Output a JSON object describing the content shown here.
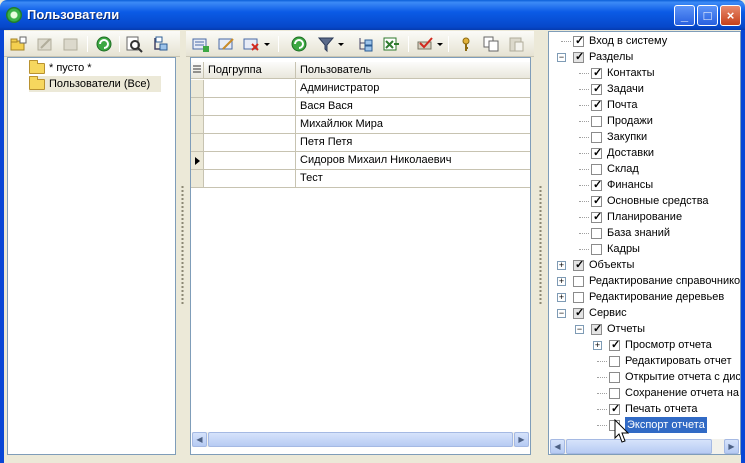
{
  "window": {
    "title": "Пользователи"
  },
  "left_panel": {
    "groups": [
      {
        "label": "* пусто *"
      },
      {
        "label": "Пользователи (Все)"
      }
    ]
  },
  "grid": {
    "columns": [
      "Подгруппа",
      "Пользователь"
    ],
    "rows": [
      {
        "subgroup": "",
        "user": "Администратор"
      },
      {
        "subgroup": "",
        "user": "Вася Вася"
      },
      {
        "subgroup": "",
        "user": "Михайлюк Мира"
      },
      {
        "subgroup": "",
        "user": "Петя Петя"
      },
      {
        "subgroup": "",
        "user": "Сидоров Михаил Николаевич"
      },
      {
        "subgroup": "",
        "user": "Тест"
      }
    ],
    "current_row": 4
  },
  "rights_tree": {
    "items": [
      {
        "label": "Вход в систему",
        "checked": true,
        "level": 0
      },
      {
        "label": "Разделы",
        "checked": true,
        "gray": true,
        "level": 0,
        "expander": "-"
      },
      {
        "label": "Контакты",
        "checked": true,
        "level": 1
      },
      {
        "label": "Задачи",
        "checked": true,
        "level": 1
      },
      {
        "label": "Почта",
        "checked": true,
        "level": 1
      },
      {
        "label": "Продажи",
        "checked": false,
        "level": 1
      },
      {
        "label": "Закупки",
        "checked": false,
        "level": 1
      },
      {
        "label": "Доставки",
        "checked": true,
        "level": 1
      },
      {
        "label": "Склад",
        "checked": false,
        "level": 1
      },
      {
        "label": "Финансы",
        "checked": true,
        "level": 1
      },
      {
        "label": "Основные средства",
        "checked": true,
        "level": 1
      },
      {
        "label": "Планирование",
        "checked": true,
        "level": 1
      },
      {
        "label": "База знаний",
        "checked": false,
        "level": 1
      },
      {
        "label": "Кадры",
        "checked": false,
        "level": 1
      },
      {
        "label": "Объекты",
        "checked": true,
        "gray": true,
        "level": 0,
        "expander": "+"
      },
      {
        "label": "Редактирование справочнико",
        "checked": false,
        "level": 0,
        "expander": "+"
      },
      {
        "label": "Редактирование деревьев",
        "checked": false,
        "level": 0,
        "expander": "+"
      },
      {
        "label": "Сервис",
        "checked": true,
        "gray": true,
        "level": 0,
        "expander": "-"
      },
      {
        "label": "Отчеты",
        "checked": true,
        "gray": true,
        "level": 1,
        "expander": "-"
      },
      {
        "label": "Просмотр отчета",
        "checked": true,
        "level": 2,
        "expander": "+"
      },
      {
        "label": "Редактировать отчет",
        "checked": false,
        "level": 2
      },
      {
        "label": "Открытие отчета с дис",
        "checked": false,
        "level": 2
      },
      {
        "label": "Сохранение отчета на",
        "checked": false,
        "level": 2
      },
      {
        "label": "Печать отчета",
        "checked": true,
        "level": 2
      },
      {
        "label": "Экспорт отчета",
        "checked": false,
        "level": 2,
        "selected": true
      }
    ]
  }
}
